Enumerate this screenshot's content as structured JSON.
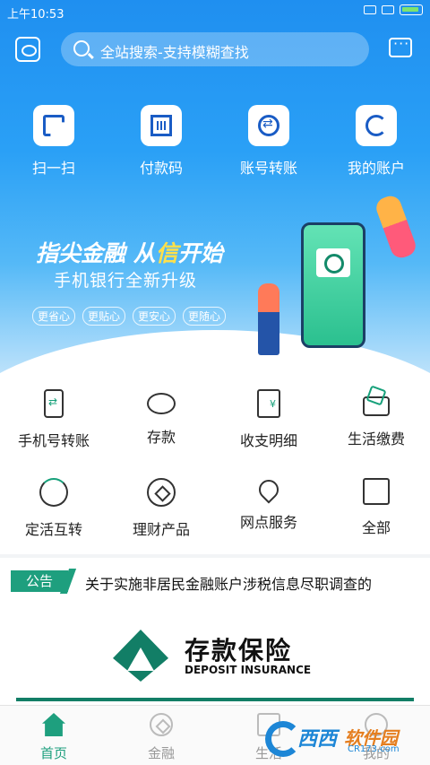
{
  "status_bar": {
    "time": "上午10:53"
  },
  "header": {
    "search_placeholder": "全站搜索-支持模糊查找"
  },
  "quick_actions": [
    {
      "label": "扫一扫",
      "icon": "scan-icon"
    },
    {
      "label": "付款码",
      "icon": "payment-code-icon"
    },
    {
      "label": "账号转账",
      "icon": "transfer-icon"
    },
    {
      "label": "我的账户",
      "icon": "account-icon"
    }
  ],
  "banner": {
    "title_part1": "指尖金融 从",
    "title_highlight": "信",
    "title_part2": "开始",
    "subtitle": "手机银行全新升级",
    "tags": [
      "更省心",
      "更贴心",
      "更安心",
      "更随心"
    ]
  },
  "menu": [
    {
      "label": "手机号转账",
      "icon": "phone-transfer-icon"
    },
    {
      "label": "存款",
      "icon": "piggy-bank-icon"
    },
    {
      "label": "收支明细",
      "icon": "bill-icon"
    },
    {
      "label": "生活缴费",
      "icon": "life-payment-icon"
    },
    {
      "label": "定活互转",
      "icon": "swap-icon"
    },
    {
      "label": "理财产品",
      "icon": "finance-icon"
    },
    {
      "label": "网点服务",
      "icon": "map-pin-icon"
    },
    {
      "label": "全部",
      "icon": "grid-icon"
    }
  ],
  "notice": {
    "tag": "公告",
    "text": "关于实施非居民金融账户涉税信息尽职调查的"
  },
  "deposit_insurance": {
    "title": "存款保险",
    "subtitle": "DEPOSIT INSURANCE"
  },
  "tabbar": [
    {
      "label": "首页",
      "icon": "home-icon",
      "active": true
    },
    {
      "label": "金融",
      "icon": "finance-tab-icon",
      "active": false
    },
    {
      "label": "生活",
      "icon": "life-tab-icon",
      "active": false
    },
    {
      "label": "我的",
      "icon": "profile-tab-icon",
      "active": false
    }
  ],
  "watermark": {
    "brand1": "西西",
    "brand2": "软件园",
    "url": "CR173.com"
  },
  "colors": {
    "primary_blue": "#2aa0f6",
    "accent_green": "#1e9f7e",
    "highlight_yellow": "#ffe04a"
  }
}
